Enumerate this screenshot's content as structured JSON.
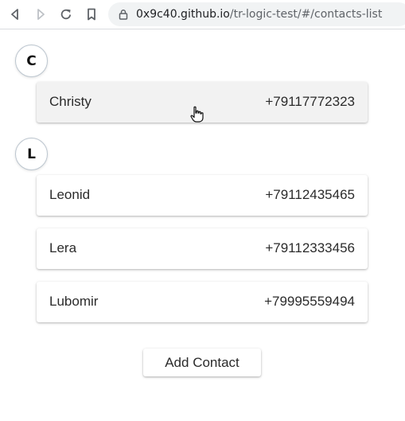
{
  "browser": {
    "url_host": "0x9c40.github.io",
    "url_path": "/tr-logic-test/#/contacts-list"
  },
  "contacts": {
    "groups": [
      {
        "letter": "C",
        "items": [
          {
            "name": "Christy",
            "phone": "+79117772323",
            "hovered": true
          }
        ]
      },
      {
        "letter": "L",
        "items": [
          {
            "name": "Leonid",
            "phone": "+79112435465"
          },
          {
            "name": "Lera",
            "phone": "+79112333456"
          },
          {
            "name": "Lubomir",
            "phone": "+79995559494"
          }
        ]
      }
    ]
  },
  "actions": {
    "add_contact_label": "Add Contact"
  },
  "icons": {
    "back": "back-arrow-icon",
    "forward": "forward-arrow-icon",
    "reload": "reload-icon",
    "bookmark": "bookmark-icon",
    "lock": "lock-icon",
    "cursor": "hand-pointer-cursor-icon"
  }
}
